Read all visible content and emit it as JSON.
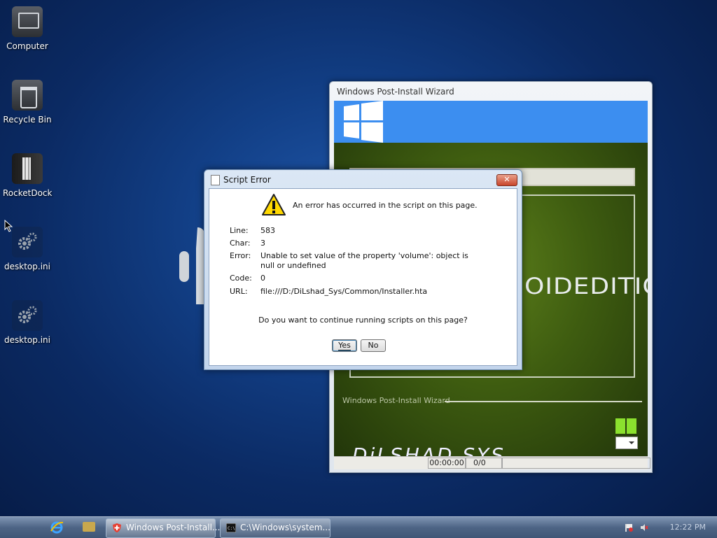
{
  "desktop": {
    "icons": [
      {
        "label": "Computer",
        "icon": "computer-icon"
      },
      {
        "label": "Recycle Bin",
        "icon": "recycle-bin-icon"
      },
      {
        "label": "RocketDock",
        "icon": "rocketdock-icon"
      },
      {
        "label": "desktop.ini",
        "icon": "settings-file-icon"
      },
      {
        "label": "desktop.ini",
        "icon": "settings-file-icon"
      }
    ]
  },
  "wizard": {
    "title": "Windows Post-Install Wizard",
    "edition_text": "OIDEDITION",
    "footer_label": "Windows Post-Install Wizard",
    "brand_text": "DiLSHAD SYS",
    "status": {
      "timer": "00:00:00",
      "count": "0/0"
    },
    "colors": {
      "banner": "#3c8ef0",
      "body": "#3e5c10",
      "accent": "#8be02e"
    }
  },
  "dialog": {
    "title": "Script Error",
    "message": "An error has occurred in the script on this page.",
    "rows": [
      {
        "label": "Line:",
        "value": "583"
      },
      {
        "label": "Char:",
        "value": "3"
      },
      {
        "label": "Error:",
        "value": "Unable to set value of the property 'volume': object is null or undefined"
      },
      {
        "label": "Code:",
        "value": "0"
      },
      {
        "label": "URL:",
        "value": "file:///D:/DiLshad_Sys/Common/Installer.hta"
      }
    ],
    "question": "Do you want to continue running scripts on this page?",
    "yes_label": "Yes",
    "no_label": "No",
    "close_glyph": "✕"
  },
  "taskbar": {
    "tasks": [
      {
        "label": "Windows Post-Install...",
        "icon": "shield-icon",
        "active": true
      },
      {
        "label": "C:\\Windows\\system...",
        "icon": "cmd-icon",
        "active": false
      }
    ],
    "clock": "12:22 PM"
  }
}
